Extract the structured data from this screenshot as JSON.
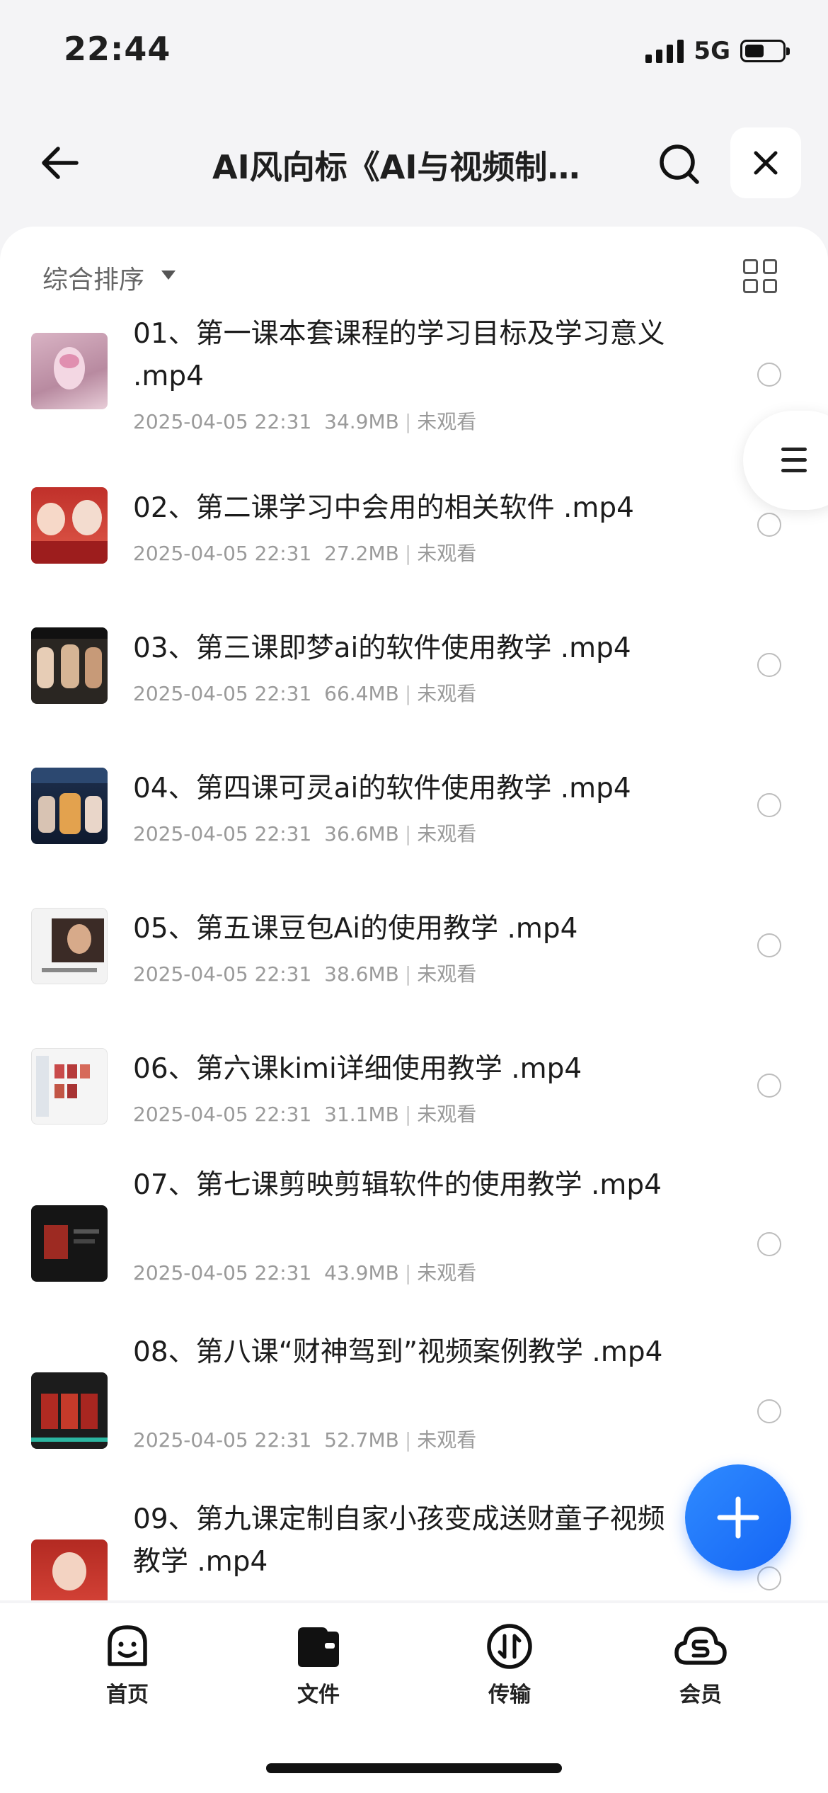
{
  "status": {
    "time": "22:44",
    "network": "5G",
    "battery_level": 0.5
  },
  "header": {
    "title": "AI风向标《AI与视频制作》"
  },
  "sort": {
    "label": "综合排序"
  },
  "files": [
    {
      "name": "01、第一课本套课程的学习目标及学习意义 .mp4",
      "date": "2025-04-05 22:31",
      "size": "34.9MB",
      "status": "未观看"
    },
    {
      "name": "02、第二课学习中会用的相关软件 .mp4",
      "date": "2025-04-05 22:31",
      "size": "27.2MB",
      "status": "未观看"
    },
    {
      "name": "03、第三课即梦ai的软件使用教学 .mp4",
      "date": "2025-04-05 22:31",
      "size": "66.4MB",
      "status": "未观看"
    },
    {
      "name": "04、第四课可灵ai的软件使用教学 .mp4",
      "date": "2025-04-05 22:31",
      "size": "36.6MB",
      "status": "未观看"
    },
    {
      "name": "05、第五课豆包Ai的使用教学 .mp4",
      "date": "2025-04-05 22:31",
      "size": "38.6MB",
      "status": "未观看"
    },
    {
      "name": "06、第六课kimi详细使用教学 .mp4",
      "date": "2025-04-05 22:31",
      "size": "31.1MB",
      "status": "未观看"
    },
    {
      "name": "07、第七课剪映剪辑软件的使用教学 .mp4",
      "date": "2025-04-05 22:31",
      "size": "43.9MB",
      "status": "未观看"
    },
    {
      "name": "08、第八课“财神驾到”视频案例教学 .mp4",
      "date": "2025-04-05 22:31",
      "size": "52.7MB",
      "status": "未观看"
    },
    {
      "name": "09、第九课定制自家小孩变成送财童子视频教学 .mp4",
      "date": "",
      "size": "",
      "status": ""
    }
  ],
  "tabs": [
    {
      "label": "首页",
      "icon": "smiley-home-icon"
    },
    {
      "label": "文件",
      "icon": "folder-icon"
    },
    {
      "label": "传输",
      "icon": "transfer-icon"
    },
    {
      "label": "会员",
      "icon": "cloud-member-icon"
    }
  ],
  "colors": {
    "accent": "#1f6fff",
    "background": "#f4f4f6",
    "meta_text": "#9a9a9a"
  }
}
